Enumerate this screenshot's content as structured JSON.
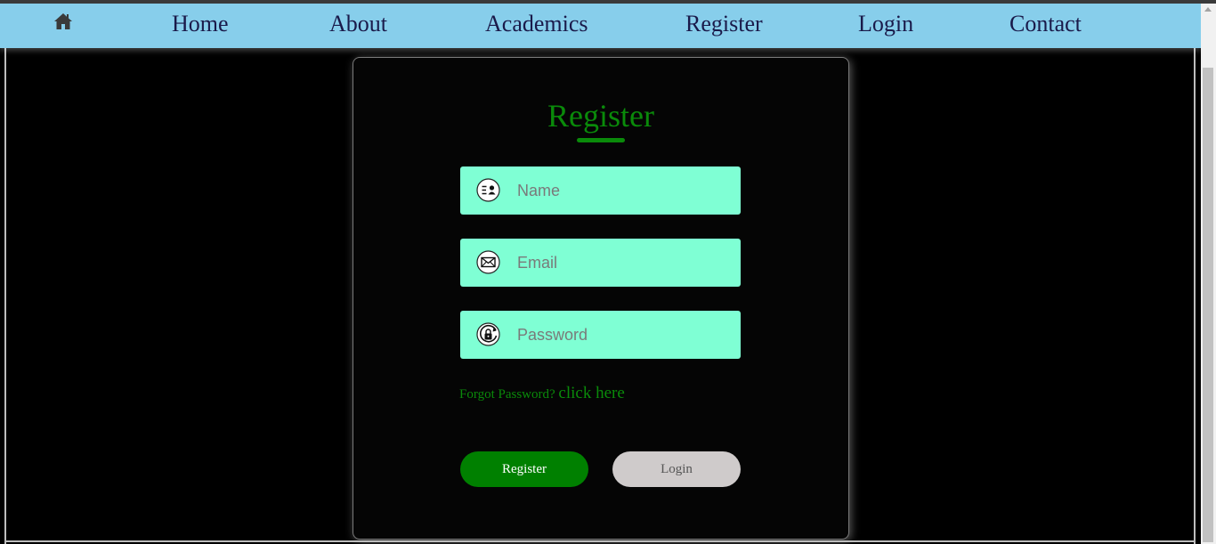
{
  "nav": {
    "home_icon": "home-icon",
    "links": [
      "Home",
      "About",
      "Academics",
      "Register",
      "Login",
      "Contact"
    ]
  },
  "form": {
    "title": "Register",
    "fields": [
      {
        "placeholder": "Name",
        "icon": "contact-card-icon"
      },
      {
        "placeholder": "Email",
        "icon": "envelope-icon"
      },
      {
        "placeholder": "Password",
        "icon": "lock-rotate-icon"
      }
    ],
    "forgot_text": "Forgot Password?",
    "forgot_link": "click here",
    "register_button": "Register",
    "login_button": "Login"
  },
  "colors": {
    "nav_background": "#87ceeb",
    "accent_green": "#008000",
    "field_background": "#7fffd4",
    "page_background": "#000000"
  }
}
